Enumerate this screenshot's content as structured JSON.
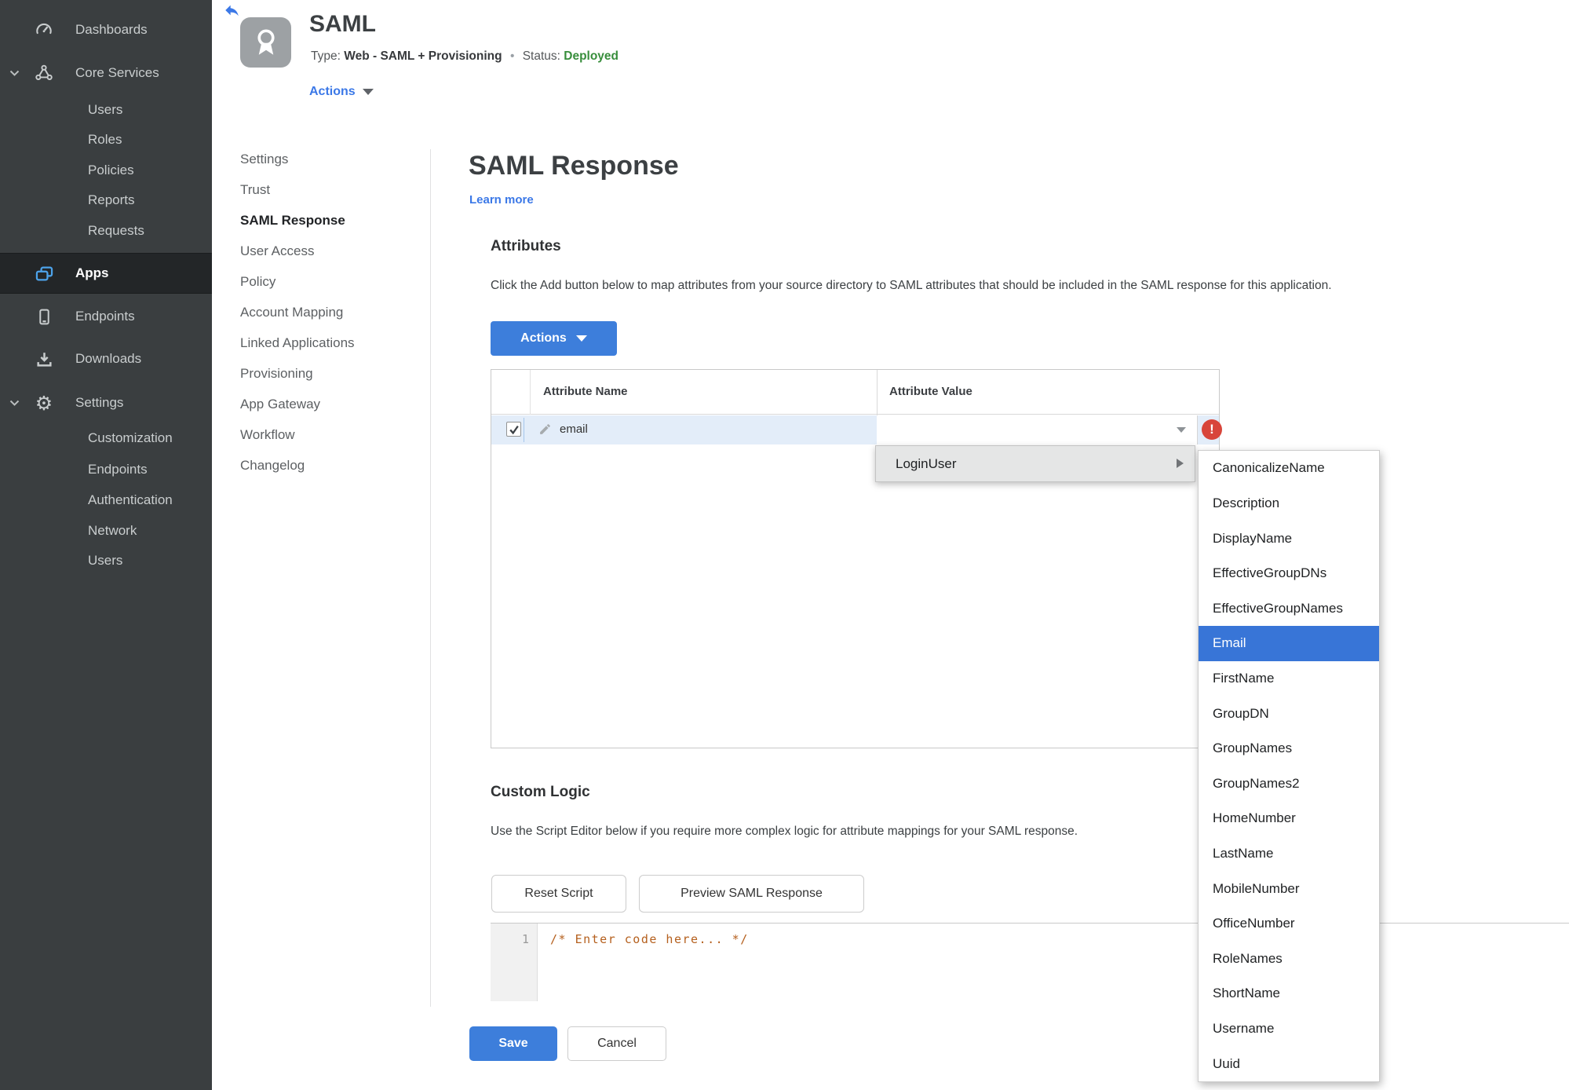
{
  "colors": {
    "accent_blue": "#3d7edb",
    "link_blue": "#3b78e7",
    "selected_option_blue": "#3875d7",
    "status_green": "#388e3c",
    "error_red": "#d8453a",
    "row_highlight": "#e3edf9",
    "sidebar_bg": "#3a3e40",
    "sidebar_selected_bg": "#232628",
    "code_text": "#b5601e"
  },
  "icons": {
    "back": "reply-arrow",
    "app_badge": "award-ribbon",
    "dashboards": "gauge",
    "core_services": "node-triangle",
    "apps": "stacked-windows",
    "endpoints": "smartphone",
    "downloads": "download-tray",
    "settings_gear": "⚙",
    "chevron_down": "v",
    "dropdown_caret": "▼",
    "submenu_arrow": "▶",
    "edit_pencil": "pencil",
    "checkbox_check": "✓",
    "error": "!"
  },
  "sidebar": {
    "dashboards": "Dashboards",
    "core_services": "Core Services",
    "core_items": [
      "Users",
      "Roles",
      "Policies",
      "Reports",
      "Requests"
    ],
    "apps": "Apps",
    "endpoints": "Endpoints",
    "downloads": "Downloads",
    "settings": "Settings",
    "settings_items": [
      "Customization",
      "Endpoints",
      "Authentication",
      "Network",
      "Users"
    ]
  },
  "header": {
    "title": "SAML",
    "type_label": "Type:",
    "type_value": "Web - SAML + Provisioning",
    "separator": "•",
    "status_label": "Status:",
    "status_value": "Deployed",
    "actions_label": "Actions"
  },
  "subnav": {
    "items": [
      "Settings",
      "Trust",
      "SAML Response",
      "User Access",
      "Policy",
      "Account Mapping",
      "Linked Applications",
      "Provisioning",
      "App Gateway",
      "Workflow",
      "Changelog"
    ],
    "active": "SAML Response"
  },
  "main": {
    "title": "SAML Response",
    "learn_more": "Learn more",
    "attributes": {
      "heading": "Attributes",
      "description": "Click the Add button below to map attributes from your source directory to SAML attributes that should be included in the SAML response for this application.",
      "actions_button": "Actions",
      "table": {
        "columns": [
          "Attribute Name",
          "Attribute Value"
        ],
        "rows": [
          {
            "name": "email",
            "value": "",
            "checked": true,
            "error": true
          }
        ]
      }
    },
    "value_menu": {
      "item": "LoginUser",
      "selected": "Email",
      "options": [
        "CanonicalizeName",
        "Description",
        "DisplayName",
        "EffectiveGroupDNs",
        "EffectiveGroupNames",
        "Email",
        "FirstName",
        "GroupDN",
        "GroupNames",
        "GroupNames2",
        "HomeNumber",
        "LastName",
        "MobileNumber",
        "OfficeNumber",
        "RoleNames",
        "ShortName",
        "Username",
        "Uuid"
      ]
    },
    "custom_logic": {
      "heading": "Custom Logic",
      "description": "Use the Script Editor below if you require more complex logic for attribute mappings for your SAML response.",
      "reset_button": "Reset Script",
      "preview_button": "Preview SAML Response",
      "editor": {
        "line_number": "1",
        "code": "/* Enter code here... */"
      }
    },
    "footer": {
      "save": "Save",
      "cancel": "Cancel"
    }
  }
}
